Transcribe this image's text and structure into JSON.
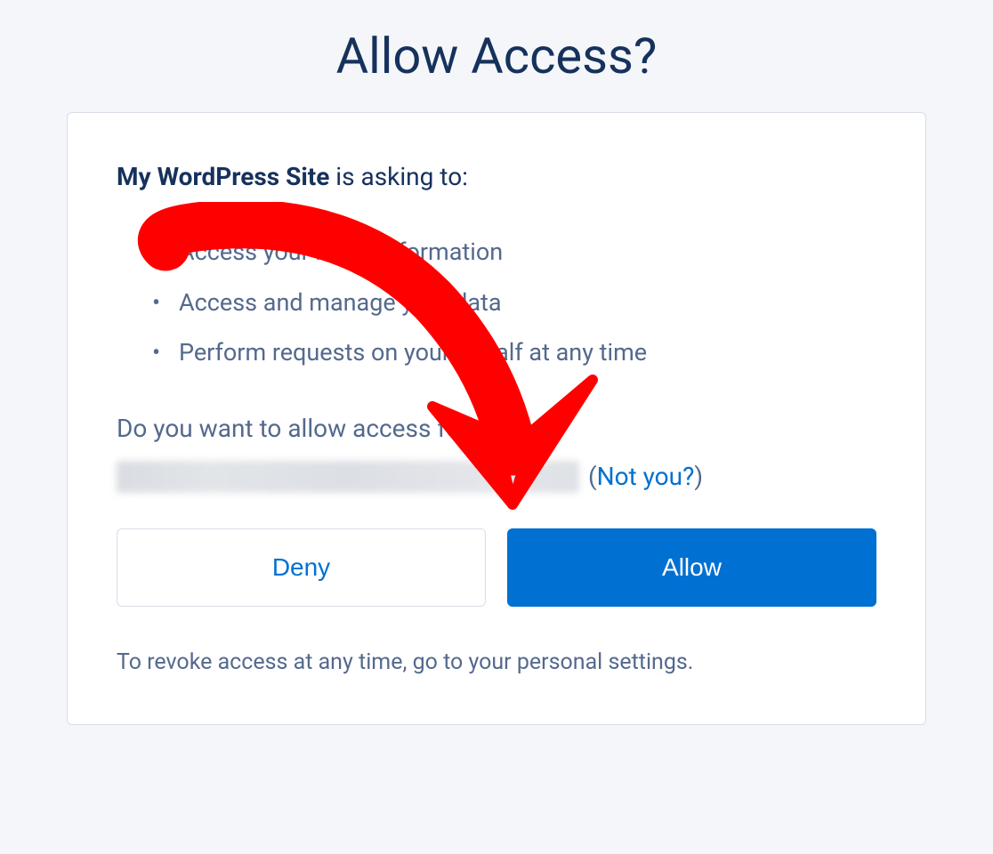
{
  "page_title": "Allow Access?",
  "asking": {
    "app_name": "My WordPress Site",
    "suffix": " is asking to:"
  },
  "permissions": [
    "Access your basic information",
    "Access and manage your data",
    "Perform requests on your behalf at any time"
  ],
  "confirm_text": "Do you want to allow access for",
  "not_you_open": "(",
  "not_you_label": "Not you?",
  "not_you_close": ")",
  "buttons": {
    "deny": "Deny",
    "allow": "Allow"
  },
  "revoke_text": "To revoke access at any time, go to your personal settings."
}
